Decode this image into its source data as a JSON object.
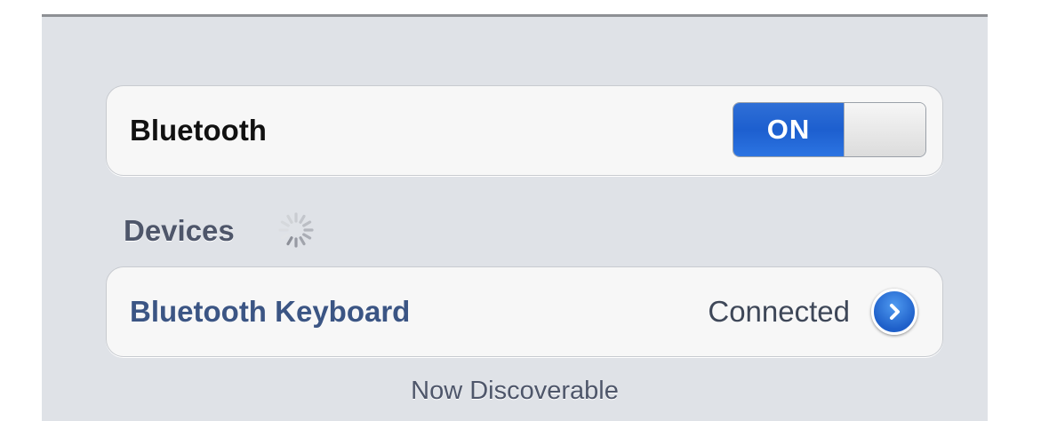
{
  "bluetooth": {
    "label": "Bluetooth",
    "toggle_state": "ON"
  },
  "devices": {
    "header": "Devices",
    "spinner_icon": "loading-spinner-icon",
    "items": [
      {
        "name": "Bluetooth Keyboard",
        "status": "Connected",
        "icon": "disclosure-chevron-icon"
      }
    ]
  },
  "footer": {
    "status": "Now Discoverable"
  },
  "colors": {
    "toggle_on": "#1d5fcf",
    "device_name": "#3b5584",
    "background": "#dfe2e7"
  }
}
